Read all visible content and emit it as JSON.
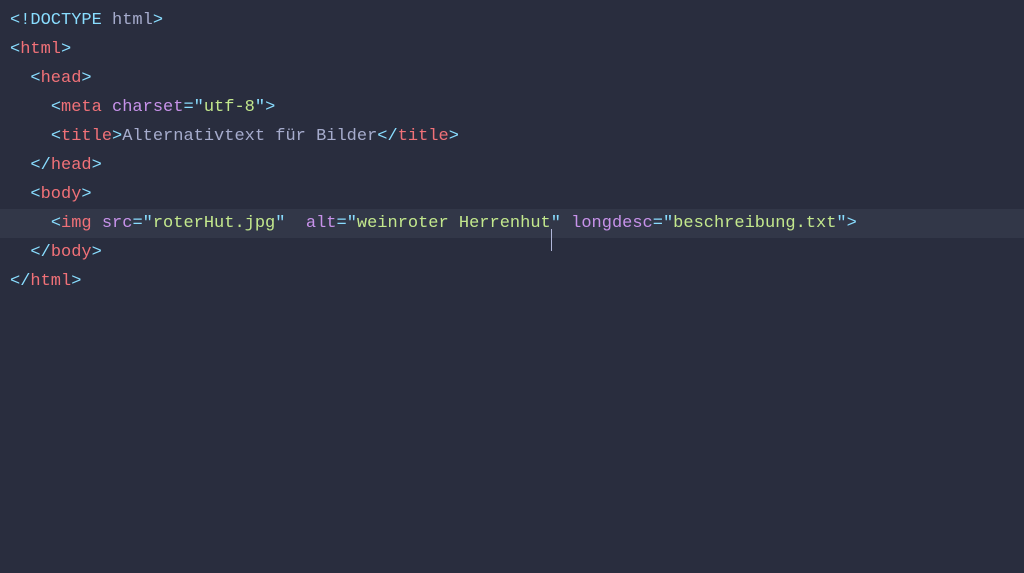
{
  "code": {
    "doctype": {
      "open": "<!",
      "kw": "DOCTYPE",
      "sp": " ",
      "name": "html",
      "close": ">"
    },
    "htmlOpen": {
      "lt": "<",
      "tag": "html",
      "gt": ">"
    },
    "headOpen": {
      "indent": "  ",
      "lt": "<",
      "tag": "head",
      "gt": ">"
    },
    "meta": {
      "indent": "    ",
      "lt": "<",
      "tag": "meta",
      "sp": " ",
      "attr": "charset",
      "eq": "=",
      "q1": "\"",
      "val": "utf-8",
      "q2": "\"",
      "gt": ">"
    },
    "title": {
      "indent": "    ",
      "openLt": "<",
      "openTag": "title",
      "openGt": ">",
      "text": "Alternativtext für Bilder",
      "closeLt": "</",
      "closeTag": "title",
      "closeGt": ">"
    },
    "headClose": {
      "indent": "  ",
      "lt": "</",
      "tag": "head",
      "gt": ">"
    },
    "bodyOpen": {
      "indent": "  ",
      "lt": "<",
      "tag": "body",
      "gt": ">"
    },
    "img": {
      "indent": "    ",
      "lt": "<",
      "tag": "img",
      "sp1": " ",
      "srcAttr": "src",
      "eq1": "=",
      "q1a": "\"",
      "srcVal": "roterHut.jpg",
      "q1b": "\"",
      "sp2": "  ",
      "altAttr": "alt",
      "eq2": "=",
      "q2a": "\"",
      "altVal": "weinroter Herrenhut",
      "q2b": "\"",
      "sp3": " ",
      "ldAttr": "longdesc",
      "eq3": "=",
      "q3a": "\"",
      "ldVal": "beschreibung.txt",
      "q3b": "\"",
      "gt": ">"
    },
    "bodyClose": {
      "indent": "  ",
      "lt": "</",
      "tag": "body",
      "gt": ">"
    },
    "htmlClose": {
      "lt": "</",
      "tag": "html",
      "gt": ">"
    }
  }
}
